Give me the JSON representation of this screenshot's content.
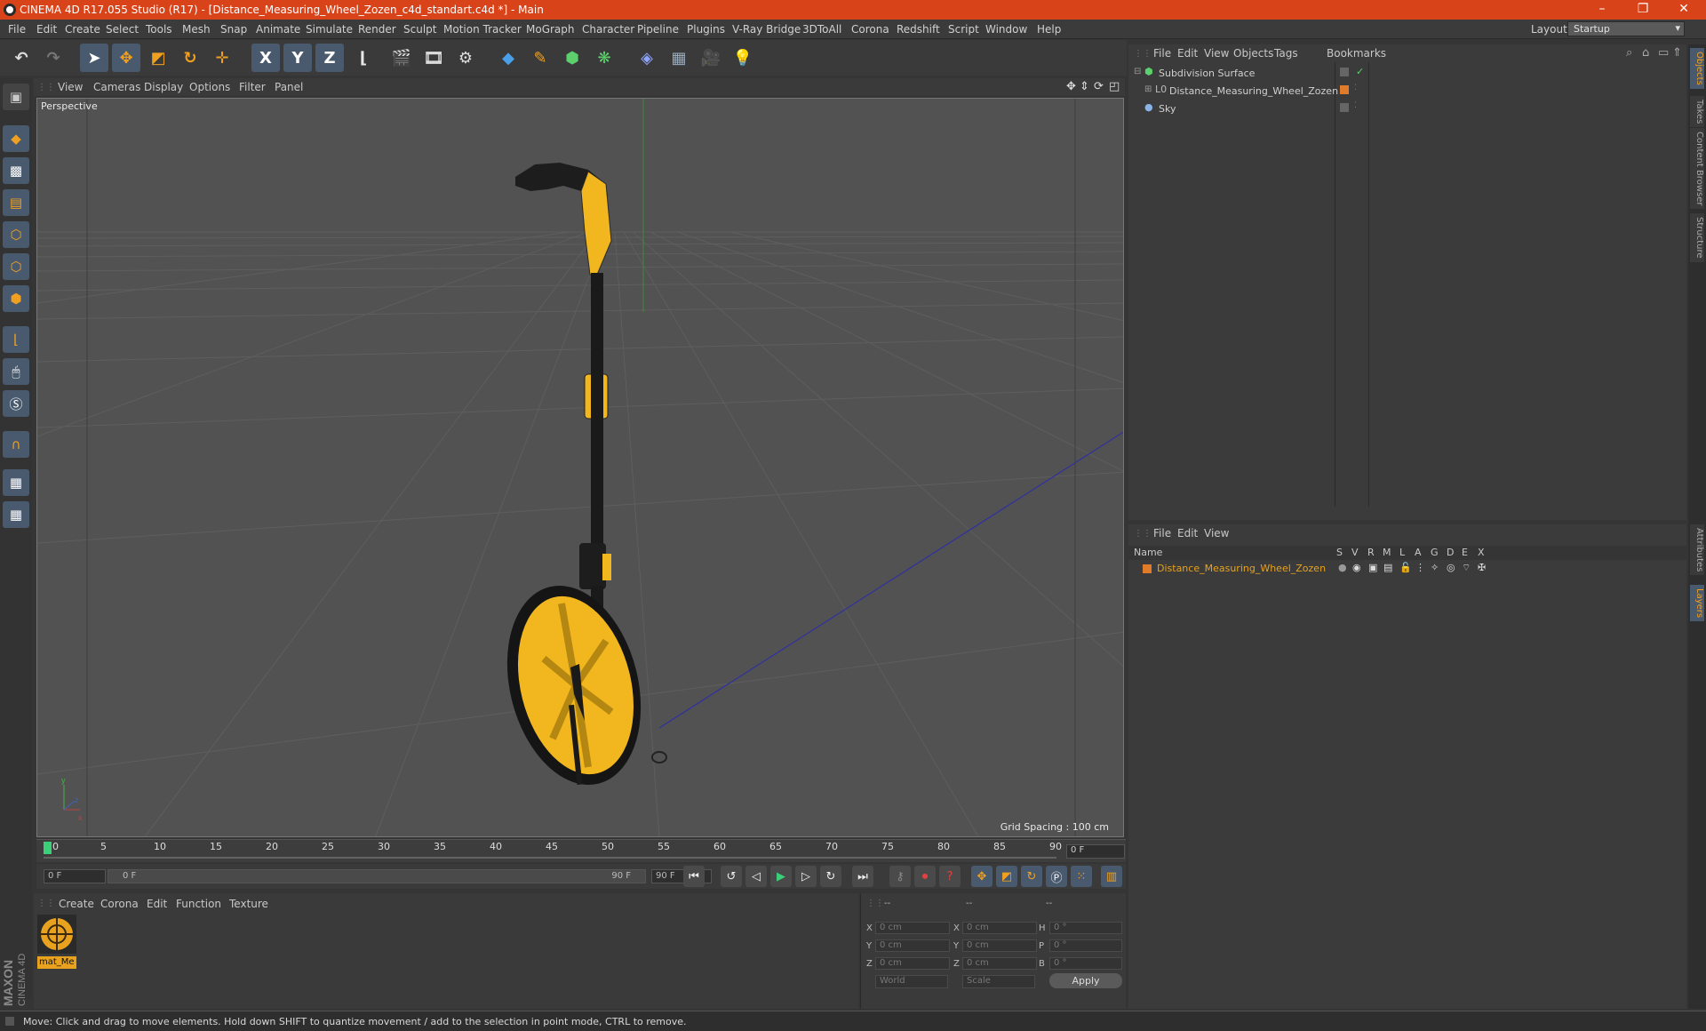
{
  "window": {
    "title": "CINEMA 4D R17.055 Studio (R17) - [Distance_Measuring_Wheel_Zozen_c4d_standart.c4d *] - Main",
    "minimize": "–",
    "restore": "❐",
    "close": "✕"
  },
  "menubar": {
    "items": [
      "File",
      "Edit",
      "Create",
      "Select",
      "Tools",
      "Mesh",
      "Snap",
      "Animate",
      "Simulate",
      "Render",
      "Sculpt",
      "Motion Tracker",
      "MoGraph",
      "Character",
      "Pipeline",
      "Plugins",
      "V-Ray Bridge",
      "3DToAll",
      "Corona",
      "Redshift",
      "Script",
      "Window",
      "Help"
    ],
    "layout_label": "Layout:",
    "layout_value": "Startup"
  },
  "toolbar": {
    "undo_icon": "undo-icon",
    "x_label": "X",
    "y_label": "Y",
    "z_label": "Z"
  },
  "viewport": {
    "menu": [
      "View",
      "Cameras",
      "Display",
      "Options",
      "Filter",
      "Panel"
    ],
    "label": "Perspective",
    "grid_spacing": "Grid Spacing : 100 cm"
  },
  "timeline": {
    "ticks": [
      "0",
      "5",
      "10",
      "15",
      "20",
      "25",
      "30",
      "35",
      "40",
      "45",
      "50",
      "55",
      "60",
      "65",
      "70",
      "75",
      "80",
      "85",
      "90"
    ],
    "current_frame": "0 F",
    "start_field": "0 F",
    "range_start": "0 F",
    "range_end": "90 F",
    "end_field": "90 F"
  },
  "material_manager": {
    "menu": [
      "Create",
      "Corona",
      "Edit",
      "Function",
      "Texture"
    ],
    "material_name": "mat_Me"
  },
  "coordinates": {
    "header": [
      "--",
      "--",
      "--"
    ],
    "pos_labels": [
      "X",
      "Y",
      "Z"
    ],
    "pos_values": [
      "0 cm",
      "0 cm",
      "0 cm"
    ],
    "size_labels": [
      "X",
      "Y",
      "Z"
    ],
    "size_values": [
      "0 cm",
      "0 cm",
      "0 cm"
    ],
    "rot_labels": [
      "H",
      "P",
      "B"
    ],
    "rot_values": [
      "0 °",
      "0 °",
      "0 °"
    ],
    "mode_world": "World",
    "mode_scale": "Scale",
    "apply": "Apply"
  },
  "object_manager": {
    "menu": [
      "File",
      "Edit",
      "View",
      "Objects",
      "Tags",
      "Bookmarks"
    ],
    "objects": [
      "Subdivision Surface",
      "Distance_Measuring_Wheel_Zozen",
      "Sky"
    ]
  },
  "layer_manager": {
    "menu": [
      "File",
      "Edit",
      "View"
    ],
    "columns": [
      "Name",
      "S",
      "V",
      "R",
      "M",
      "L",
      "A",
      "G",
      "D",
      "E",
      "X"
    ],
    "layer_name": "Distance_Measuring_Wheel_Zozen"
  },
  "right_tabs": [
    "Objects",
    "Takes",
    "Content Browser",
    "Structure",
    "Attributes",
    "Layers"
  ],
  "status": "Move: Click and drag to move elements. Hold down SHIFT to quantize movement / add to the selection in point mode, CTRL to remove.",
  "branding": {
    "maxon": "MAXON",
    "c4d": "CINEMA 4D"
  },
  "colors": {
    "title_bar": "#d9431a",
    "accent_orange": "#e8a21e",
    "model_yellow": "#f2b71e",
    "layer_orange": "#e07b2a"
  }
}
